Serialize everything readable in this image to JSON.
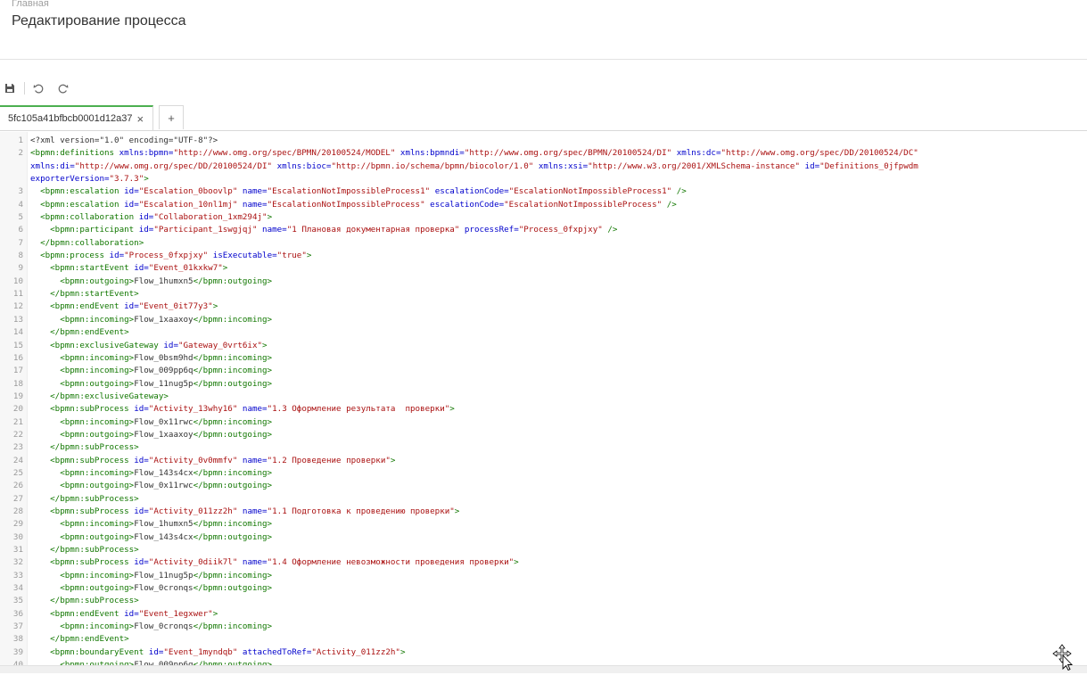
{
  "header": {
    "breadcrumb": "Главная",
    "title": "Редактирование процесса"
  },
  "toolbar": {
    "save": "save-icon",
    "undo": "undo-icon",
    "redo": "redo-icon"
  },
  "tabs": {
    "active_label": "5fc105a41bfbcb0001d12a37",
    "close": "×",
    "add": "+"
  },
  "editor": {
    "lines": [
      {
        "n": "1",
        "t": [
          [
            "t",
            "<?xml version=\"1.0\" encoding=\"UTF-8\"?>"
          ]
        ]
      },
      {
        "n": "2",
        "t": [
          [
            "g",
            "<bpmn:definitions "
          ],
          [
            "a",
            "xmlns:bpmn="
          ],
          [
            "s",
            "\"http://www.omg.org/spec/BPMN/20100524/MODEL\""
          ],
          [
            "x",
            " "
          ],
          [
            "a",
            "xmlns:bpmndi="
          ],
          [
            "s",
            "\"http://www.omg.org/spec/BPMN/20100524/DI\""
          ],
          [
            "x",
            " "
          ],
          [
            "a",
            "xmlns:dc="
          ],
          [
            "s",
            "\"http://www.omg.org/spec/DD/20100524/DC\""
          ]
        ]
      },
      {
        "n": "",
        "t": [
          [
            "a",
            "xmlns:di="
          ],
          [
            "s",
            "\"http://www.omg.org/spec/DD/20100524/DI\""
          ],
          [
            "x",
            " "
          ],
          [
            "a",
            "xmlns:bioc="
          ],
          [
            "s",
            "\"http://bpmn.io/schema/bpmn/biocolor/1.0\""
          ],
          [
            "x",
            " "
          ],
          [
            "a",
            "xmlns:xsi="
          ],
          [
            "s",
            "\"http://www.w3.org/2001/XMLSchema-instance\""
          ],
          [
            "x",
            " "
          ],
          [
            "a",
            "id="
          ],
          [
            "s",
            "\"Definitions_0jfpwdm"
          ]
        ]
      },
      {
        "n": "",
        "t": [
          [
            "a",
            "exporterVersion="
          ],
          [
            "s",
            "\"3.7.3\""
          ],
          [
            "g",
            ">"
          ]
        ]
      },
      {
        "n": "3",
        "t": [
          [
            "x",
            "  "
          ],
          [
            "g",
            "<bpmn:escalation "
          ],
          [
            "a",
            "id="
          ],
          [
            "s",
            "\"Escalation_0boovlp\""
          ],
          [
            "x",
            " "
          ],
          [
            "a",
            "name="
          ],
          [
            "s",
            "\"EscalationNotImpossibleProcess1\""
          ],
          [
            "x",
            " "
          ],
          [
            "a",
            "escalationCode="
          ],
          [
            "s",
            "\"EscalationNotImpossibleProcess1\""
          ],
          [
            "g",
            " />"
          ]
        ]
      },
      {
        "n": "4",
        "t": [
          [
            "x",
            "  "
          ],
          [
            "g",
            "<bpmn:escalation "
          ],
          [
            "a",
            "id="
          ],
          [
            "s",
            "\"Escalation_10nl1mj\""
          ],
          [
            "x",
            " "
          ],
          [
            "a",
            "name="
          ],
          [
            "s",
            "\"EscalationNotImpossibleProcess\""
          ],
          [
            "x",
            " "
          ],
          [
            "a",
            "escalationCode="
          ],
          [
            "s",
            "\"EscalationNotImpossibleProcess\""
          ],
          [
            "g",
            " />"
          ]
        ]
      },
      {
        "n": "5",
        "t": [
          [
            "x",
            "  "
          ],
          [
            "g",
            "<bpmn:collaboration "
          ],
          [
            "a",
            "id="
          ],
          [
            "s",
            "\"Collaboration_1xm294j\""
          ],
          [
            "g",
            ">"
          ]
        ]
      },
      {
        "n": "6",
        "t": [
          [
            "x",
            "    "
          ],
          [
            "g",
            "<bpmn:participant "
          ],
          [
            "a",
            "id="
          ],
          [
            "s",
            "\"Participant_1swgjqj\""
          ],
          [
            "x",
            " "
          ],
          [
            "a",
            "name="
          ],
          [
            "s",
            "\"1 Плановая документарная проверка\""
          ],
          [
            "x",
            " "
          ],
          [
            "a",
            "processRef="
          ],
          [
            "s",
            "\"Process_0fxpjxy\""
          ],
          [
            "g",
            " />"
          ]
        ]
      },
      {
        "n": "7",
        "t": [
          [
            "x",
            "  "
          ],
          [
            "g",
            "</bpmn:collaboration>"
          ]
        ]
      },
      {
        "n": "8",
        "t": [
          [
            "x",
            "  "
          ],
          [
            "g",
            "<bpmn:process "
          ],
          [
            "a",
            "id="
          ],
          [
            "s",
            "\"Process_0fxpjxy\""
          ],
          [
            "x",
            " "
          ],
          [
            "a",
            "isExecutable="
          ],
          [
            "s",
            "\"true\""
          ],
          [
            "g",
            ">"
          ]
        ]
      },
      {
        "n": "9",
        "t": [
          [
            "x",
            "    "
          ],
          [
            "g",
            "<bpmn:startEvent "
          ],
          [
            "a",
            "id="
          ],
          [
            "s",
            "\"Event_01kxkw7\""
          ],
          [
            "g",
            ">"
          ]
        ]
      },
      {
        "n": "10",
        "t": [
          [
            "x",
            "      "
          ],
          [
            "g",
            "<bpmn:outgoing>"
          ],
          [
            "x",
            "Flow_1humxn5"
          ],
          [
            "g",
            "</bpmn:outgoing>"
          ]
        ]
      },
      {
        "n": "11",
        "t": [
          [
            "x",
            "    "
          ],
          [
            "g",
            "</bpmn:startEvent>"
          ]
        ]
      },
      {
        "n": "12",
        "t": [
          [
            "x",
            "    "
          ],
          [
            "g",
            "<bpmn:endEvent "
          ],
          [
            "a",
            "id="
          ],
          [
            "s",
            "\"Event_0it77y3\""
          ],
          [
            "g",
            ">"
          ]
        ]
      },
      {
        "n": "13",
        "t": [
          [
            "x",
            "      "
          ],
          [
            "g",
            "<bpmn:incoming>"
          ],
          [
            "x",
            "Flow_1xaaxoy"
          ],
          [
            "g",
            "</bpmn:incoming>"
          ]
        ]
      },
      {
        "n": "14",
        "t": [
          [
            "x",
            "    "
          ],
          [
            "g",
            "</bpmn:endEvent>"
          ]
        ]
      },
      {
        "n": "15",
        "t": [
          [
            "x",
            "    "
          ],
          [
            "g",
            "<bpmn:exclusiveGateway "
          ],
          [
            "a",
            "id="
          ],
          [
            "s",
            "\"Gateway_0vrt6ix\""
          ],
          [
            "g",
            ">"
          ]
        ]
      },
      {
        "n": "16",
        "t": [
          [
            "x",
            "      "
          ],
          [
            "g",
            "<bpmn:incoming>"
          ],
          [
            "x",
            "Flow_0bsm9hd"
          ],
          [
            "g",
            "</bpmn:incoming>"
          ]
        ]
      },
      {
        "n": "17",
        "t": [
          [
            "x",
            "      "
          ],
          [
            "g",
            "<bpmn:incoming>"
          ],
          [
            "x",
            "Flow_009pp6q"
          ],
          [
            "g",
            "</bpmn:incoming>"
          ]
        ]
      },
      {
        "n": "18",
        "t": [
          [
            "x",
            "      "
          ],
          [
            "g",
            "<bpmn:outgoing>"
          ],
          [
            "x",
            "Flow_11nug5p"
          ],
          [
            "g",
            "</bpmn:outgoing>"
          ]
        ]
      },
      {
        "n": "19",
        "t": [
          [
            "x",
            "    "
          ],
          [
            "g",
            "</bpmn:exclusiveGateway>"
          ]
        ]
      },
      {
        "n": "20",
        "t": [
          [
            "x",
            "    "
          ],
          [
            "g",
            "<bpmn:subProcess "
          ],
          [
            "a",
            "id="
          ],
          [
            "s",
            "\"Activity_13why16\""
          ],
          [
            "x",
            " "
          ],
          [
            "a",
            "name="
          ],
          [
            "s",
            "\"1.3 Оформление результата  проверки\""
          ],
          [
            "g",
            ">"
          ]
        ]
      },
      {
        "n": "21",
        "t": [
          [
            "x",
            "      "
          ],
          [
            "g",
            "<bpmn:incoming>"
          ],
          [
            "x",
            "Flow_0x11rwc"
          ],
          [
            "g",
            "</bpmn:incoming>"
          ]
        ]
      },
      {
        "n": "22",
        "t": [
          [
            "x",
            "      "
          ],
          [
            "g",
            "<bpmn:outgoing>"
          ],
          [
            "x",
            "Flow_1xaaxoy"
          ],
          [
            "g",
            "</bpmn:outgoing>"
          ]
        ]
      },
      {
        "n": "23",
        "t": [
          [
            "x",
            "    "
          ],
          [
            "g",
            "</bpmn:subProcess>"
          ]
        ]
      },
      {
        "n": "24",
        "t": [
          [
            "x",
            "    "
          ],
          [
            "g",
            "<bpmn:subProcess "
          ],
          [
            "a",
            "id="
          ],
          [
            "s",
            "\"Activity_0v0mmfv\""
          ],
          [
            "x",
            " "
          ],
          [
            "a",
            "name="
          ],
          [
            "s",
            "\"1.2 Проведение проверки\""
          ],
          [
            "g",
            ">"
          ]
        ]
      },
      {
        "n": "25",
        "t": [
          [
            "x",
            "      "
          ],
          [
            "g",
            "<bpmn:incoming>"
          ],
          [
            "x",
            "Flow_143s4cx"
          ],
          [
            "g",
            "</bpmn:incoming>"
          ]
        ]
      },
      {
        "n": "26",
        "t": [
          [
            "x",
            "      "
          ],
          [
            "g",
            "<bpmn:outgoing>"
          ],
          [
            "x",
            "Flow_0x11rwc"
          ],
          [
            "g",
            "</bpmn:outgoing>"
          ]
        ]
      },
      {
        "n": "27",
        "t": [
          [
            "x",
            "    "
          ],
          [
            "g",
            "</bpmn:subProcess>"
          ]
        ]
      },
      {
        "n": "28",
        "t": [
          [
            "x",
            "    "
          ],
          [
            "g",
            "<bpmn:subProcess "
          ],
          [
            "a",
            "id="
          ],
          [
            "s",
            "\"Activity_011zz2h\""
          ],
          [
            "x",
            " "
          ],
          [
            "a",
            "name="
          ],
          [
            "s",
            "\"1.1 Подготовка к проведению проверки\""
          ],
          [
            "g",
            ">"
          ]
        ]
      },
      {
        "n": "29",
        "t": [
          [
            "x",
            "      "
          ],
          [
            "g",
            "<bpmn:incoming>"
          ],
          [
            "x",
            "Flow_1humxn5"
          ],
          [
            "g",
            "</bpmn:incoming>"
          ]
        ]
      },
      {
        "n": "30",
        "t": [
          [
            "x",
            "      "
          ],
          [
            "g",
            "<bpmn:outgoing>"
          ],
          [
            "x",
            "Flow_143s4cx"
          ],
          [
            "g",
            "</bpmn:outgoing>"
          ]
        ]
      },
      {
        "n": "31",
        "t": [
          [
            "x",
            "    "
          ],
          [
            "g",
            "</bpmn:subProcess>"
          ]
        ]
      },
      {
        "n": "32",
        "t": [
          [
            "x",
            "    "
          ],
          [
            "g",
            "<bpmn:subProcess "
          ],
          [
            "a",
            "id="
          ],
          [
            "s",
            "\"Activity_0diik7l\""
          ],
          [
            "x",
            " "
          ],
          [
            "a",
            "name="
          ],
          [
            "s",
            "\"1.4 Оформление невозможности проведения проверки\""
          ],
          [
            "g",
            ">"
          ]
        ]
      },
      {
        "n": "33",
        "t": [
          [
            "x",
            "      "
          ],
          [
            "g",
            "<bpmn:incoming>"
          ],
          [
            "x",
            "Flow_11nug5p"
          ],
          [
            "g",
            "</bpmn:incoming>"
          ]
        ]
      },
      {
        "n": "34",
        "t": [
          [
            "x",
            "      "
          ],
          [
            "g",
            "<bpmn:outgoing>"
          ],
          [
            "x",
            "Flow_0cronqs"
          ],
          [
            "g",
            "</bpmn:outgoing>"
          ]
        ]
      },
      {
        "n": "35",
        "t": [
          [
            "x",
            "    "
          ],
          [
            "g",
            "</bpmn:subProcess>"
          ]
        ]
      },
      {
        "n": "36",
        "t": [
          [
            "x",
            "    "
          ],
          [
            "g",
            "<bpmn:endEvent "
          ],
          [
            "a",
            "id="
          ],
          [
            "s",
            "\"Event_1egxwer\""
          ],
          [
            "g",
            ">"
          ]
        ]
      },
      {
        "n": "37",
        "t": [
          [
            "x",
            "      "
          ],
          [
            "g",
            "<bpmn:incoming>"
          ],
          [
            "x",
            "Flow_0cronqs"
          ],
          [
            "g",
            "</bpmn:incoming>"
          ]
        ]
      },
      {
        "n": "38",
        "t": [
          [
            "x",
            "    "
          ],
          [
            "g",
            "</bpmn:endEvent>"
          ]
        ]
      },
      {
        "n": "39",
        "t": [
          [
            "x",
            "    "
          ],
          [
            "g",
            "<bpmn:boundaryEvent "
          ],
          [
            "a",
            "id="
          ],
          [
            "s",
            "\"Event_1myndqb\""
          ],
          [
            "x",
            " "
          ],
          [
            "a",
            "attachedToRef="
          ],
          [
            "s",
            "\"Activity_011zz2h\""
          ],
          [
            "g",
            ">"
          ]
        ]
      },
      {
        "n": "40",
        "t": [
          [
            "x",
            "      "
          ],
          [
            "g",
            "<bpmn:outgoing>"
          ],
          [
            "x",
            "Flow_009pp6q"
          ],
          [
            "g",
            "</bpmn:outgoing>"
          ]
        ]
      }
    ]
  }
}
